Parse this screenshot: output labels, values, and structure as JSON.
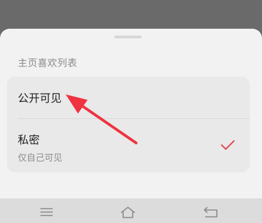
{
  "sheet": {
    "section_title": "主页喜欢列表",
    "options": [
      {
        "label": "公开可见",
        "sublabel": "",
        "selected": false
      },
      {
        "label": "私密",
        "sublabel": "仅自己可见",
        "selected": true
      }
    ]
  },
  "colors": {
    "check": "#e24a57",
    "annotation_arrow": "#ef3340",
    "sheet_background": "#f2f2f2",
    "card_background": "#e9e9e9"
  },
  "navbar": {
    "icons": [
      "menu-icon",
      "home-icon",
      "back-icon"
    ]
  }
}
